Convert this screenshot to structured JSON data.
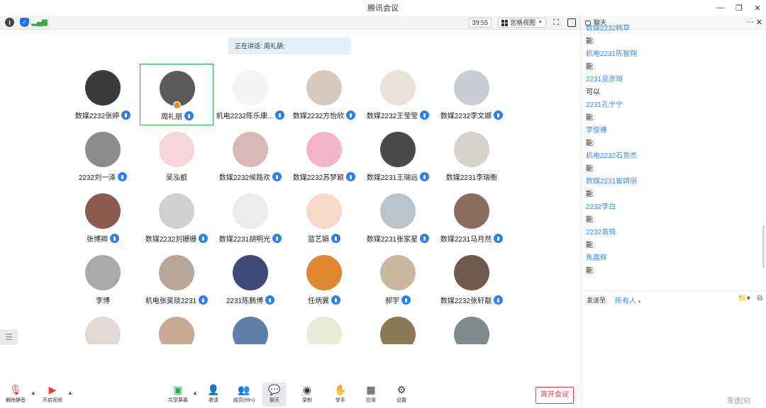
{
  "window": {
    "title": "腾讯会议"
  },
  "infobar": {
    "timer": "39:55",
    "view_mode": "宫格视图"
  },
  "speaking": {
    "text": "正在讲话: 周礼朋;"
  },
  "participants": [
    {
      "name": "数媒2232张婷",
      "bg": "#3a3a3a",
      "mic": true
    },
    {
      "name": "周礼朋",
      "bg": "#5a5a5a",
      "mic": true,
      "active": true
    },
    {
      "name": "机电2232陈乐康...",
      "bg": "#f4f4f4",
      "mic": true
    },
    {
      "name": "数媒2232方怡欣",
      "bg": "#d8c9bf",
      "mic": true
    },
    {
      "name": "数媒2232王莹莹",
      "bg": "#e9e2d6",
      "mic": true
    },
    {
      "name": "数媒2232李文娜",
      "bg": "#c9cdd3",
      "mic": true
    },
    {
      "name": "2232刘一泽",
      "bg": "#8a8d8a",
      "mic": true
    },
    {
      "name": "吴泓叡",
      "bg": "#f3d6d9",
      "mic": false
    },
    {
      "name": "数媒2232候路欢",
      "bg": "#d9b9b5",
      "mic": true
    },
    {
      "name": "数媒2232苏梦颖",
      "bg": "#f2b6c8",
      "mic": true
    },
    {
      "name": "数媒2231王瑞远",
      "bg": "#4a4a4a",
      "mic": true
    },
    {
      "name": "数媒2231李瑞衡",
      "bg": "#d6d2cc",
      "mic": false
    },
    {
      "name": "张博卿",
      "bg": "#8c5b4f",
      "mic": true
    },
    {
      "name": "数媒2232刘姗姗",
      "bg": "#cfcfcf",
      "mic": true
    },
    {
      "name": "数媒2231胡明光",
      "bg": "#ececec",
      "mic": true
    },
    {
      "name": "蓝艺娟",
      "bg": "#f7d9c9",
      "mic": true
    },
    {
      "name": "数媒2231张家星",
      "bg": "#b9c3cc",
      "mic": true
    },
    {
      "name": "数媒2231马月然",
      "bg": "#8a6d5e",
      "mic": true
    },
    {
      "name": "李博",
      "bg": "#a8aaa8",
      "mic": false
    },
    {
      "name": "机电张昊琰2231",
      "bg": "#b8a699",
      "mic": true
    },
    {
      "name": "2231陈鹏博",
      "bg": "#3e4a7a",
      "mic": true
    },
    {
      "name": "任炳翼",
      "bg": "#e0862f",
      "mic": true
    },
    {
      "name": "郝宇",
      "bg": "#c9b8a0",
      "mic": true
    },
    {
      "name": "数媒2232张轩靓",
      "bg": "#6d5a4c",
      "mic": true
    },
    {
      "name": "",
      "bg": "#e2d8d4",
      "mic": false
    },
    {
      "name": "",
      "bg": "#c8a994",
      "mic": false
    },
    {
      "name": "",
      "bg": "#5e7fa8",
      "mic": false
    },
    {
      "name": "",
      "bg": "#e8ecd6",
      "mic": false
    },
    {
      "name": "",
      "bg": "#8a7a55",
      "mic": false
    },
    {
      "name": "",
      "bg": "#7f8c8d",
      "mic": false
    }
  ],
  "toolbar": {
    "mute": "解除静音",
    "video": "开启视频",
    "share": "共享屏幕",
    "invite": "邀请",
    "members": "成员(99+)",
    "chat": "聊天",
    "record": "录制",
    "raise": "举手",
    "apps": "应用",
    "settings": "设置",
    "leave": "离开会议"
  },
  "chat": {
    "title": "聊天",
    "messages": [
      {
        "sender": "数媒2232韩草",
        "text": "能"
      },
      {
        "sender": "机电2231陈智翔",
        "text": "能"
      },
      {
        "sender": "2231吴彦琦",
        "text": "可以"
      },
      {
        "sender": "2231孔宁宁",
        "text": "能"
      },
      {
        "sender": "李俊峰",
        "text": "能"
      },
      {
        "sender": "机电2232石贵杰",
        "text": "能"
      },
      {
        "sender": "数媒2231崔婧丽",
        "text": "能"
      },
      {
        "sender": "2232李白",
        "text": "能"
      },
      {
        "sender": "2232袁琦",
        "text": "能"
      },
      {
        "sender": "焦嘉辉",
        "text": "能"
      }
    ],
    "send_to_label": "发送至:",
    "send_target": "所有人",
    "send_button": "发送(S)"
  },
  "colors": {
    "accent": "#3d8ee0",
    "active_border": "#2ea84a",
    "leave": "#e03d3d"
  }
}
